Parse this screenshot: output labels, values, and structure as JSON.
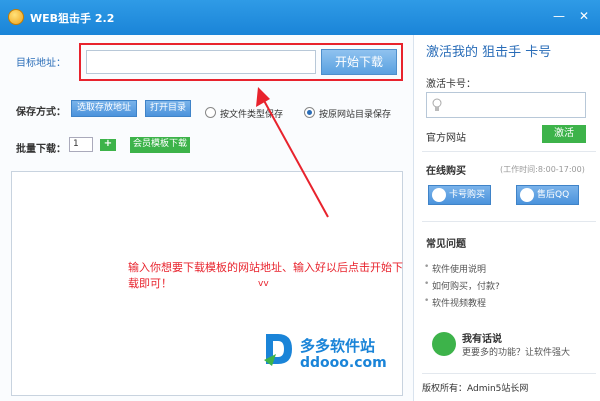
{
  "window": {
    "title": "WEB狙击手 2.2",
    "minimize": "—",
    "close": "✕"
  },
  "target": {
    "label": "目标地址：",
    "url_value": "",
    "start_button": "开始下载"
  },
  "save": {
    "label": "保存方式：",
    "choose_folder_button": "选取存放地址",
    "open_folder_button": "打开目录",
    "option_by_type": "按文件类型保存",
    "option_by_site": "按原网站目录保存",
    "selected": "by_site"
  },
  "batch": {
    "label": "批量下载：",
    "count": "1",
    "add_button": "+",
    "member_button": "会员模板下载"
  },
  "instructions": {
    "text": "输入你想要下载模板的网站地址、输入好以后点击开始下载即可！",
    "signature": "vv"
  },
  "watermark": {
    "name_cn": "多多软件站",
    "name_en": "ddooo.com"
  },
  "activation": {
    "title": "激活我的 狙击手 卡号",
    "card_label": "激活卡号：",
    "card_value": "",
    "official_site": "官方网站",
    "activate_button": "激活"
  },
  "purchase": {
    "title": "在线购买",
    "hours": "(工作时间:8:00-17:00)",
    "buy_card_button": "卡号购买",
    "qq_group_button": "售后QQ群"
  },
  "faq": {
    "title": "常见问题",
    "items": [
      "软件使用说明",
      "如何购买，付款?",
      "软件视频教程"
    ]
  },
  "feedback": {
    "title": "我有话说",
    "subtitle": "更要多的功能？让软件强大"
  },
  "footer": {
    "copyright": "版权所有：Admin5站长网"
  }
}
